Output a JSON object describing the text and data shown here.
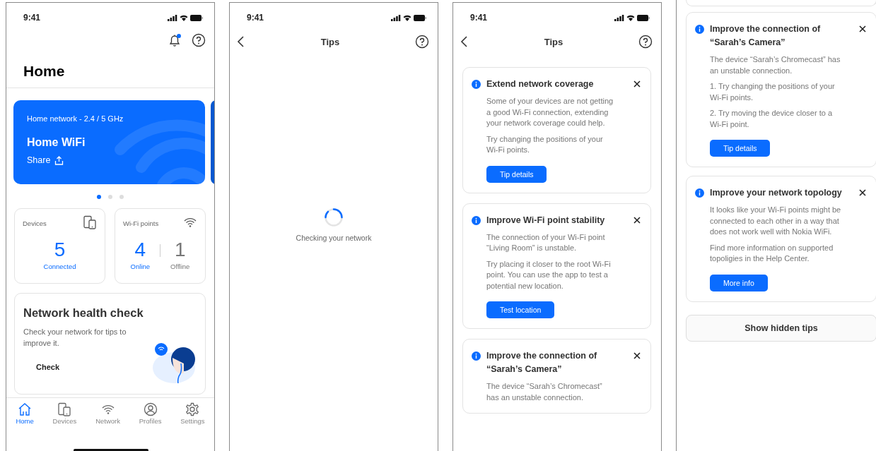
{
  "home": {
    "status_time": "9:41",
    "has_notification": true,
    "title": "Home",
    "network_card": {
      "subtitle": "Home network - 2.4 / 5 GHz",
      "name": "Home WiFi",
      "share": "Share"
    },
    "carousel_dots": [
      {
        "selected": true
      },
      {
        "selected": false
      },
      {
        "selected": false
      }
    ],
    "devices_tile": {
      "label": "Devices",
      "count": "5",
      "caption": "Connected"
    },
    "wifi_tile": {
      "label": "Wi-Fi points",
      "online_count": "4",
      "online_label": "Online",
      "offline_count": "1",
      "offline_label": "Offline"
    },
    "health_card": {
      "title": "Network health check",
      "text": "Check your network for tips to improve it.",
      "button": "Check"
    },
    "tabs": [
      {
        "kind": "home",
        "label": "Home",
        "selected": true
      },
      {
        "kind": "devices",
        "label": "Devices",
        "selected": false
      },
      {
        "kind": "network",
        "label": "Network",
        "selected": false
      },
      {
        "kind": "profiles",
        "label": "Profiles",
        "selected": false
      },
      {
        "kind": "settings",
        "label": "Settings",
        "selected": false
      }
    ]
  },
  "loading": {
    "status_time": "9:41",
    "title": "Tips",
    "message": "Checking your network"
  },
  "tips": {
    "status_time": "9:41",
    "title": "Tips",
    "cards": [
      {
        "title": "Extend network coverage",
        "paragraphs": [
          "Some of your devices are not getting a good Wi-Fi connection, extending your network coverage could help.",
          "Try changing the positions of your Wi-Fi points."
        ],
        "button": "Tip details"
      },
      {
        "title": "Improve Wi-Fi point stability",
        "paragraphs": [
          "The connection of your Wi-Fi point “Living Room” is unstable.",
          "Try placing it closer to the root Wi-Fi point. You can use the app to test a potential new location."
        ],
        "button": "Test location"
      },
      {
        "title": "Improve the connection of “Sarah’s Camera”",
        "paragraphs": [
          "The device “Sarah’s Chromecast” has an unstable connection."
        ]
      }
    ]
  },
  "tips_scrolled": {
    "cards": [
      {
        "title": "Improve the connection of “Sarah’s Camera”",
        "paragraphs": [
          "The device “Sarah’s Chromecast” has an unstable connection.",
          "1. Try changing the positions of your Wi-Fi points.",
          "2. Try moving the device closer to a Wi-Fi point."
        ],
        "button": "Tip details"
      },
      {
        "title": "Improve your network topology",
        "paragraphs": [
          "It looks like your Wi-Fi points might be connected to each other in a way that does not work well with Nokia WiFi.",
          "Find more information on supported topoligies in the Help Center."
        ],
        "button": "More info"
      }
    ],
    "show_hidden_button": "Show hidden tips"
  }
}
